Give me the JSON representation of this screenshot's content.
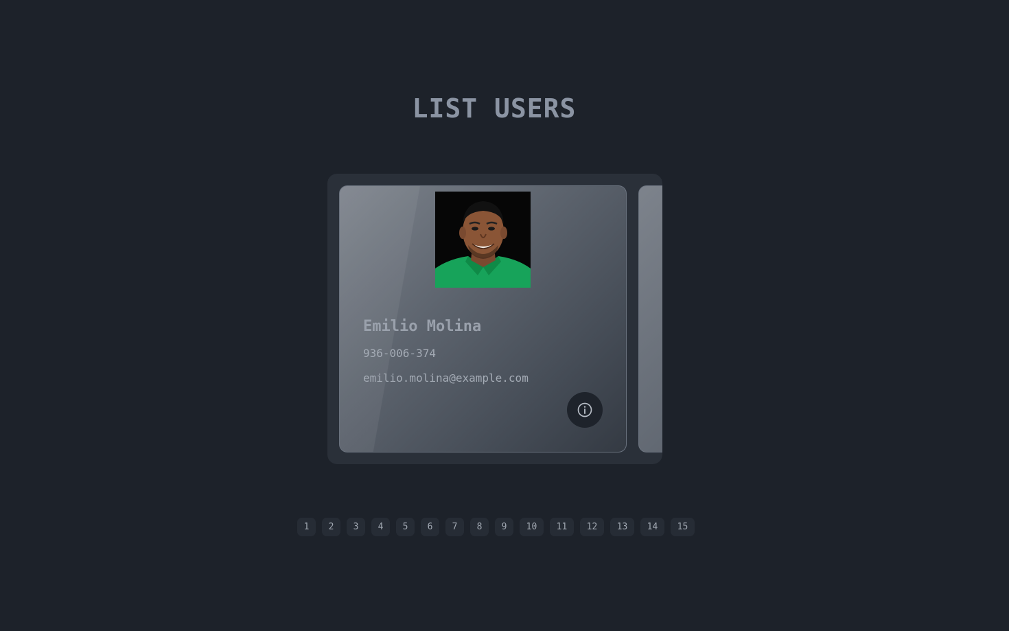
{
  "header": {
    "title": "LIST USERS"
  },
  "users": [
    {
      "name": "Emilio Molina",
      "phone": "936-006-374",
      "email": "emilio.molina@example.com",
      "avatar_alt": "Emilio Molina",
      "info_icon": "info-icon"
    }
  ],
  "pagination": {
    "pages": [
      "1",
      "2",
      "3",
      "4",
      "5",
      "6",
      "7",
      "8",
      "9",
      "10",
      "11",
      "12",
      "13",
      "14",
      "15"
    ]
  },
  "colors": {
    "background": "#1d222a",
    "card_accent": "#5d646e",
    "title": "#8b94a3"
  }
}
